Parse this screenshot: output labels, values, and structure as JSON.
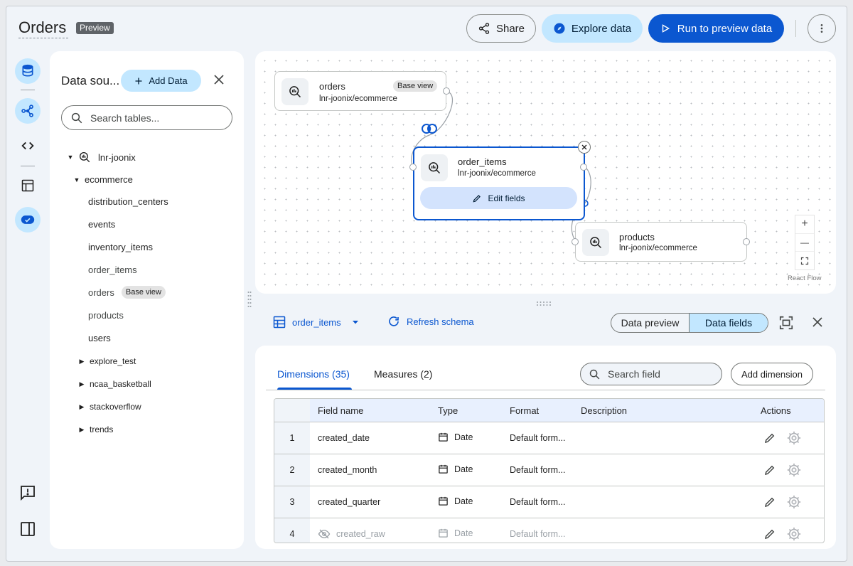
{
  "header": {
    "title": "Orders",
    "badge": "Preview",
    "share_label": "Share",
    "explore_label": "Explore data",
    "run_label": "Run to preview data"
  },
  "left_rail": {
    "items": [
      "database-icon",
      "schema-icon",
      "code-icon",
      "table-icon",
      "toggle-icon"
    ],
    "bottom_items": [
      "feedback-icon",
      "side-panel-icon"
    ]
  },
  "data_sources": {
    "title": "Data sou...",
    "add_label": "Add Data",
    "search_placeholder": "Search tables...",
    "tree": {
      "project": "lnr-joonix",
      "dataset": "ecommerce",
      "tables": [
        "distribution_centers",
        "events",
        "inventory_items",
        "order_items",
        "orders",
        "products",
        "users"
      ],
      "orders_chip": "Base view",
      "other_datasets": [
        "explore_test",
        "ncaa_basketball",
        "stackoverflow",
        "trends"
      ]
    }
  },
  "canvas": {
    "nodes": [
      {
        "name": "orders",
        "path": "lnr-joonix/ecommerce",
        "chip": "Base view"
      },
      {
        "name": "order_items",
        "path": "lnr-joonix/ecommerce",
        "action": "Edit fields"
      },
      {
        "name": "products",
        "path": "lnr-joonix/ecommerce"
      }
    ],
    "attribution": "React Flow",
    "zoom_in": "+",
    "zoom_out": "—"
  },
  "toolbar": {
    "selected_table": "order_items",
    "refresh_label": "Refresh schema",
    "segment_preview": "Data preview",
    "segment_fields": "Data fields"
  },
  "fields": {
    "tab_dimensions": "Dimensions (35)",
    "tab_measures": "Measures (2)",
    "search_placeholder": "Search field",
    "add_dimension_label": "Add dimension",
    "columns": [
      "Field name",
      "Type",
      "Format",
      "Description",
      "Actions"
    ],
    "rows": [
      {
        "index": "1",
        "field": "created_date",
        "type": "Date",
        "format": "Default form..."
      },
      {
        "index": "2",
        "field": "created_month",
        "type": "Date",
        "format": "Default form..."
      },
      {
        "index": "3",
        "field": "created_quarter",
        "type": "Date",
        "format": "Default form..."
      },
      {
        "index": "4",
        "field": "created_raw",
        "type": "Date",
        "format": "Default form..."
      }
    ]
  },
  "colors": {
    "accent": "#0b57d0",
    "accent_light": "#c2e7ff",
    "background": "#f0f4f9"
  }
}
